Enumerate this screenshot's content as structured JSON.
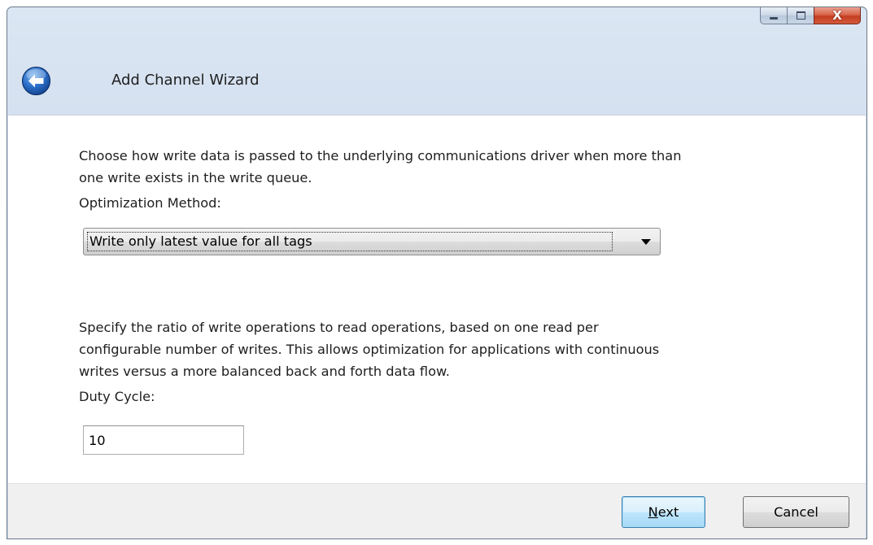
{
  "window": {
    "title": "Add Channel Wizard",
    "controls": {
      "minimize": "minimize-icon",
      "maximize": "maximize-icon",
      "close_label": "X"
    }
  },
  "back_icon": "back-arrow-icon",
  "content": {
    "optimization_description": "Choose how write data is passed to the underlying communications driver when more than one write exists in the write queue.",
    "optimization_description_lines": [
      "Choose how write data is passed to the underlying communications driver when more than",
      "one write exists in the write queue."
    ],
    "optimization_label": "Optimization Method:",
    "optimization_selected": "Write only latest value for all tags",
    "duty_description_lines": [
      "Specify the ratio of write operations to read operations, based on one read per",
      "configurable number of writes. This allows optimization for applications with continuous",
      "writes versus a more balanced back and forth data flow."
    ],
    "duty_label": "Duty Cycle:",
    "duty_value": "10"
  },
  "footer": {
    "next_mnemonic": "N",
    "next_rest": "ext",
    "cancel_label": "Cancel"
  },
  "colors": {
    "title_bar": "#cfdced",
    "close_button": "#c43d21",
    "content_bg": "#ffffff",
    "footer_bg": "#f0f0f0",
    "back_button": "#1b5fb8"
  }
}
